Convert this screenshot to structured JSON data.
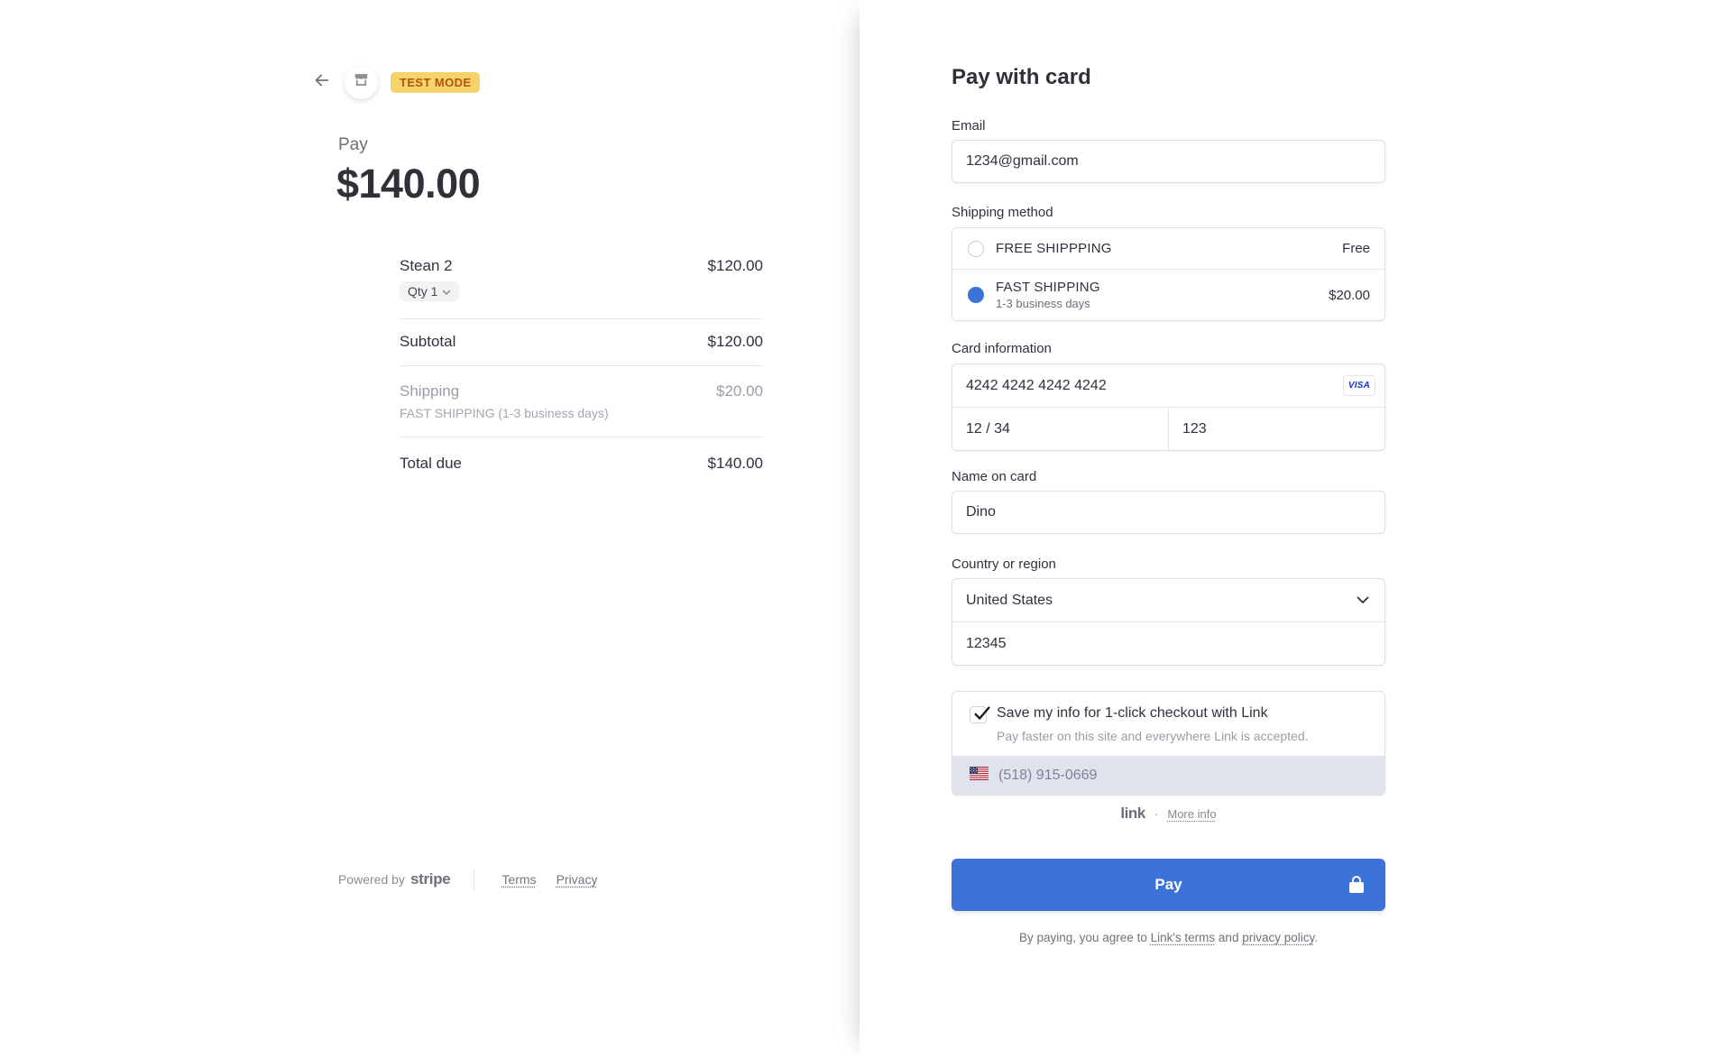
{
  "merchant_header": {
    "test_mode_badge": "TEST MODE"
  },
  "order": {
    "pay_label": "Pay",
    "total_amount": "$140.00",
    "item": {
      "name": "Stean 2",
      "qty_label": "Qty 1",
      "amount": "$120.00"
    },
    "subtotal_label": "Subtotal",
    "subtotal_amount": "$120.00",
    "shipping_label": "Shipping",
    "shipping_desc": "FAST SHIPPING (1-3 business days)",
    "shipping_amount": "$20.00",
    "total_due_label": "Total due",
    "total_due_amount": "$140.00"
  },
  "left_footer": {
    "powered_by": "Powered by",
    "stripe_wordmark": "stripe",
    "terms": "Terms",
    "privacy": "Privacy"
  },
  "form": {
    "title": "Pay with card",
    "email": {
      "label": "Email",
      "value": "1234@gmail.com"
    },
    "shipping_method": {
      "label": "Shipping method",
      "options": [
        {
          "name": "FREE SHIPPPING",
          "price": "Free",
          "selected": false
        },
        {
          "name": "FAST SHIPPING",
          "desc": "1-3 business days",
          "price": "$20.00",
          "selected": true
        }
      ]
    },
    "card": {
      "label": "Card information",
      "number": "4242 4242 4242 4242",
      "brand": "VISA",
      "expiry": "12 / 34",
      "cvc": "123"
    },
    "name_on_card": {
      "label": "Name on card",
      "value": "Dino"
    },
    "country": {
      "label": "Country or region",
      "value": "United States",
      "zip": "12345"
    },
    "link": {
      "save_label": "Save my info for 1-click checkout with Link",
      "save_desc": "Pay faster on this site and everywhere Link is accepted.",
      "phone_placeholder": "(518) 915-0669",
      "wordmark": "link",
      "dot": "·",
      "more_info": "More info"
    },
    "pay_button": "Pay",
    "agreement": {
      "prefix": "By paying, you agree to ",
      "link_terms": "Link's terms",
      "middle": " and ",
      "link_privacy": "privacy policy",
      "suffix": "."
    }
  },
  "colors": {
    "accent_blue": "#3b73d8",
    "test_badge_bg": "#f6d26a",
    "test_badge_text": "#b3560c",
    "phone_field_bg": "#dfe3ee",
    "visa_blue": "#1434cb"
  },
  "icons": {
    "back": "left-arrow",
    "store": "storefront",
    "qty_chevron": "chevron-down",
    "country_chevron": "chevron-down",
    "checkbox_check": "checkmark",
    "us_flag": "us-flag",
    "lock": "padlock"
  }
}
